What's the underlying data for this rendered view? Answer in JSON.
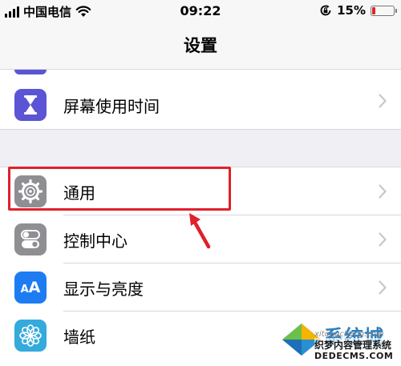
{
  "status_bar": {
    "carrier": "中国电信",
    "time": "09:22",
    "battery_percent": "15%",
    "battery_level": 0.15,
    "icons": [
      "signal-icon",
      "wifi-icon",
      "orientation-lock-icon",
      "battery-icon"
    ]
  },
  "nav": {
    "title": "设置"
  },
  "groups": [
    {
      "items": [
        {
          "label": "屏幕使用时间",
          "icon": "hourglass-icon",
          "color": "#5b55d6"
        }
      ]
    },
    {
      "items": [
        {
          "label": "通用",
          "icon": "gear-icon",
          "color": "#8e8e93"
        },
        {
          "label": "控制中心",
          "icon": "toggle-switches-icon",
          "color": "#8e8e93"
        },
        {
          "label": "显示与亮度",
          "icon": "text-size-icon",
          "color": "#1e7cf2"
        },
        {
          "label": "墙纸",
          "icon": "flower-icon",
          "color": "#35aadc"
        }
      ]
    }
  ],
  "annotation": {
    "highlight_color": "#e0202a"
  },
  "watermark": {
    "brand": "系统城",
    "domain_sub": "xitongcheng.com",
    "cn_text": "织梦内容管理系统",
    "domain": "DEDECMS.COM"
  }
}
